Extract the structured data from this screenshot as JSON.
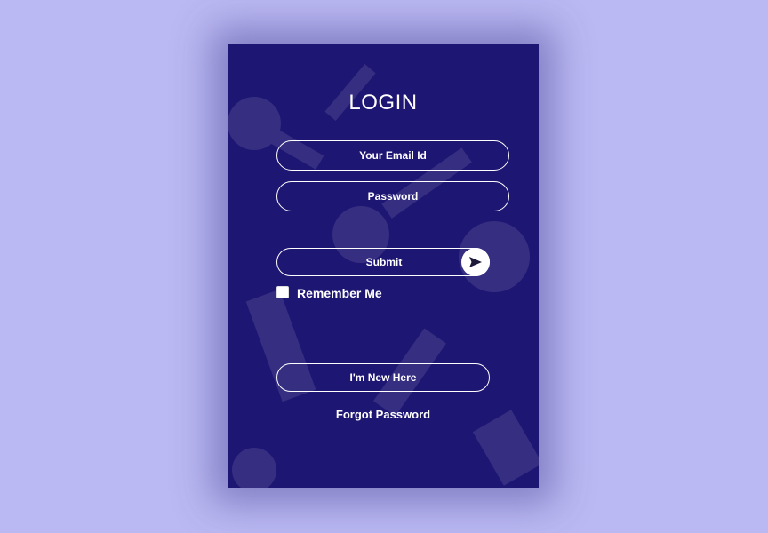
{
  "login": {
    "title": "LOGIN",
    "email_placeholder": "Your Email Id",
    "password_placeholder": "Password",
    "submit_label": "Submit",
    "remember_label": "Remember Me",
    "new_here_label": "I'm New Here",
    "forgot_label": "Forgot Password"
  },
  "icons": {
    "submit": "send-arrow-icon"
  },
  "colors": {
    "page_background": "#bbb9f3",
    "card_background": "#1e1673",
    "text": "#ffffff"
  }
}
